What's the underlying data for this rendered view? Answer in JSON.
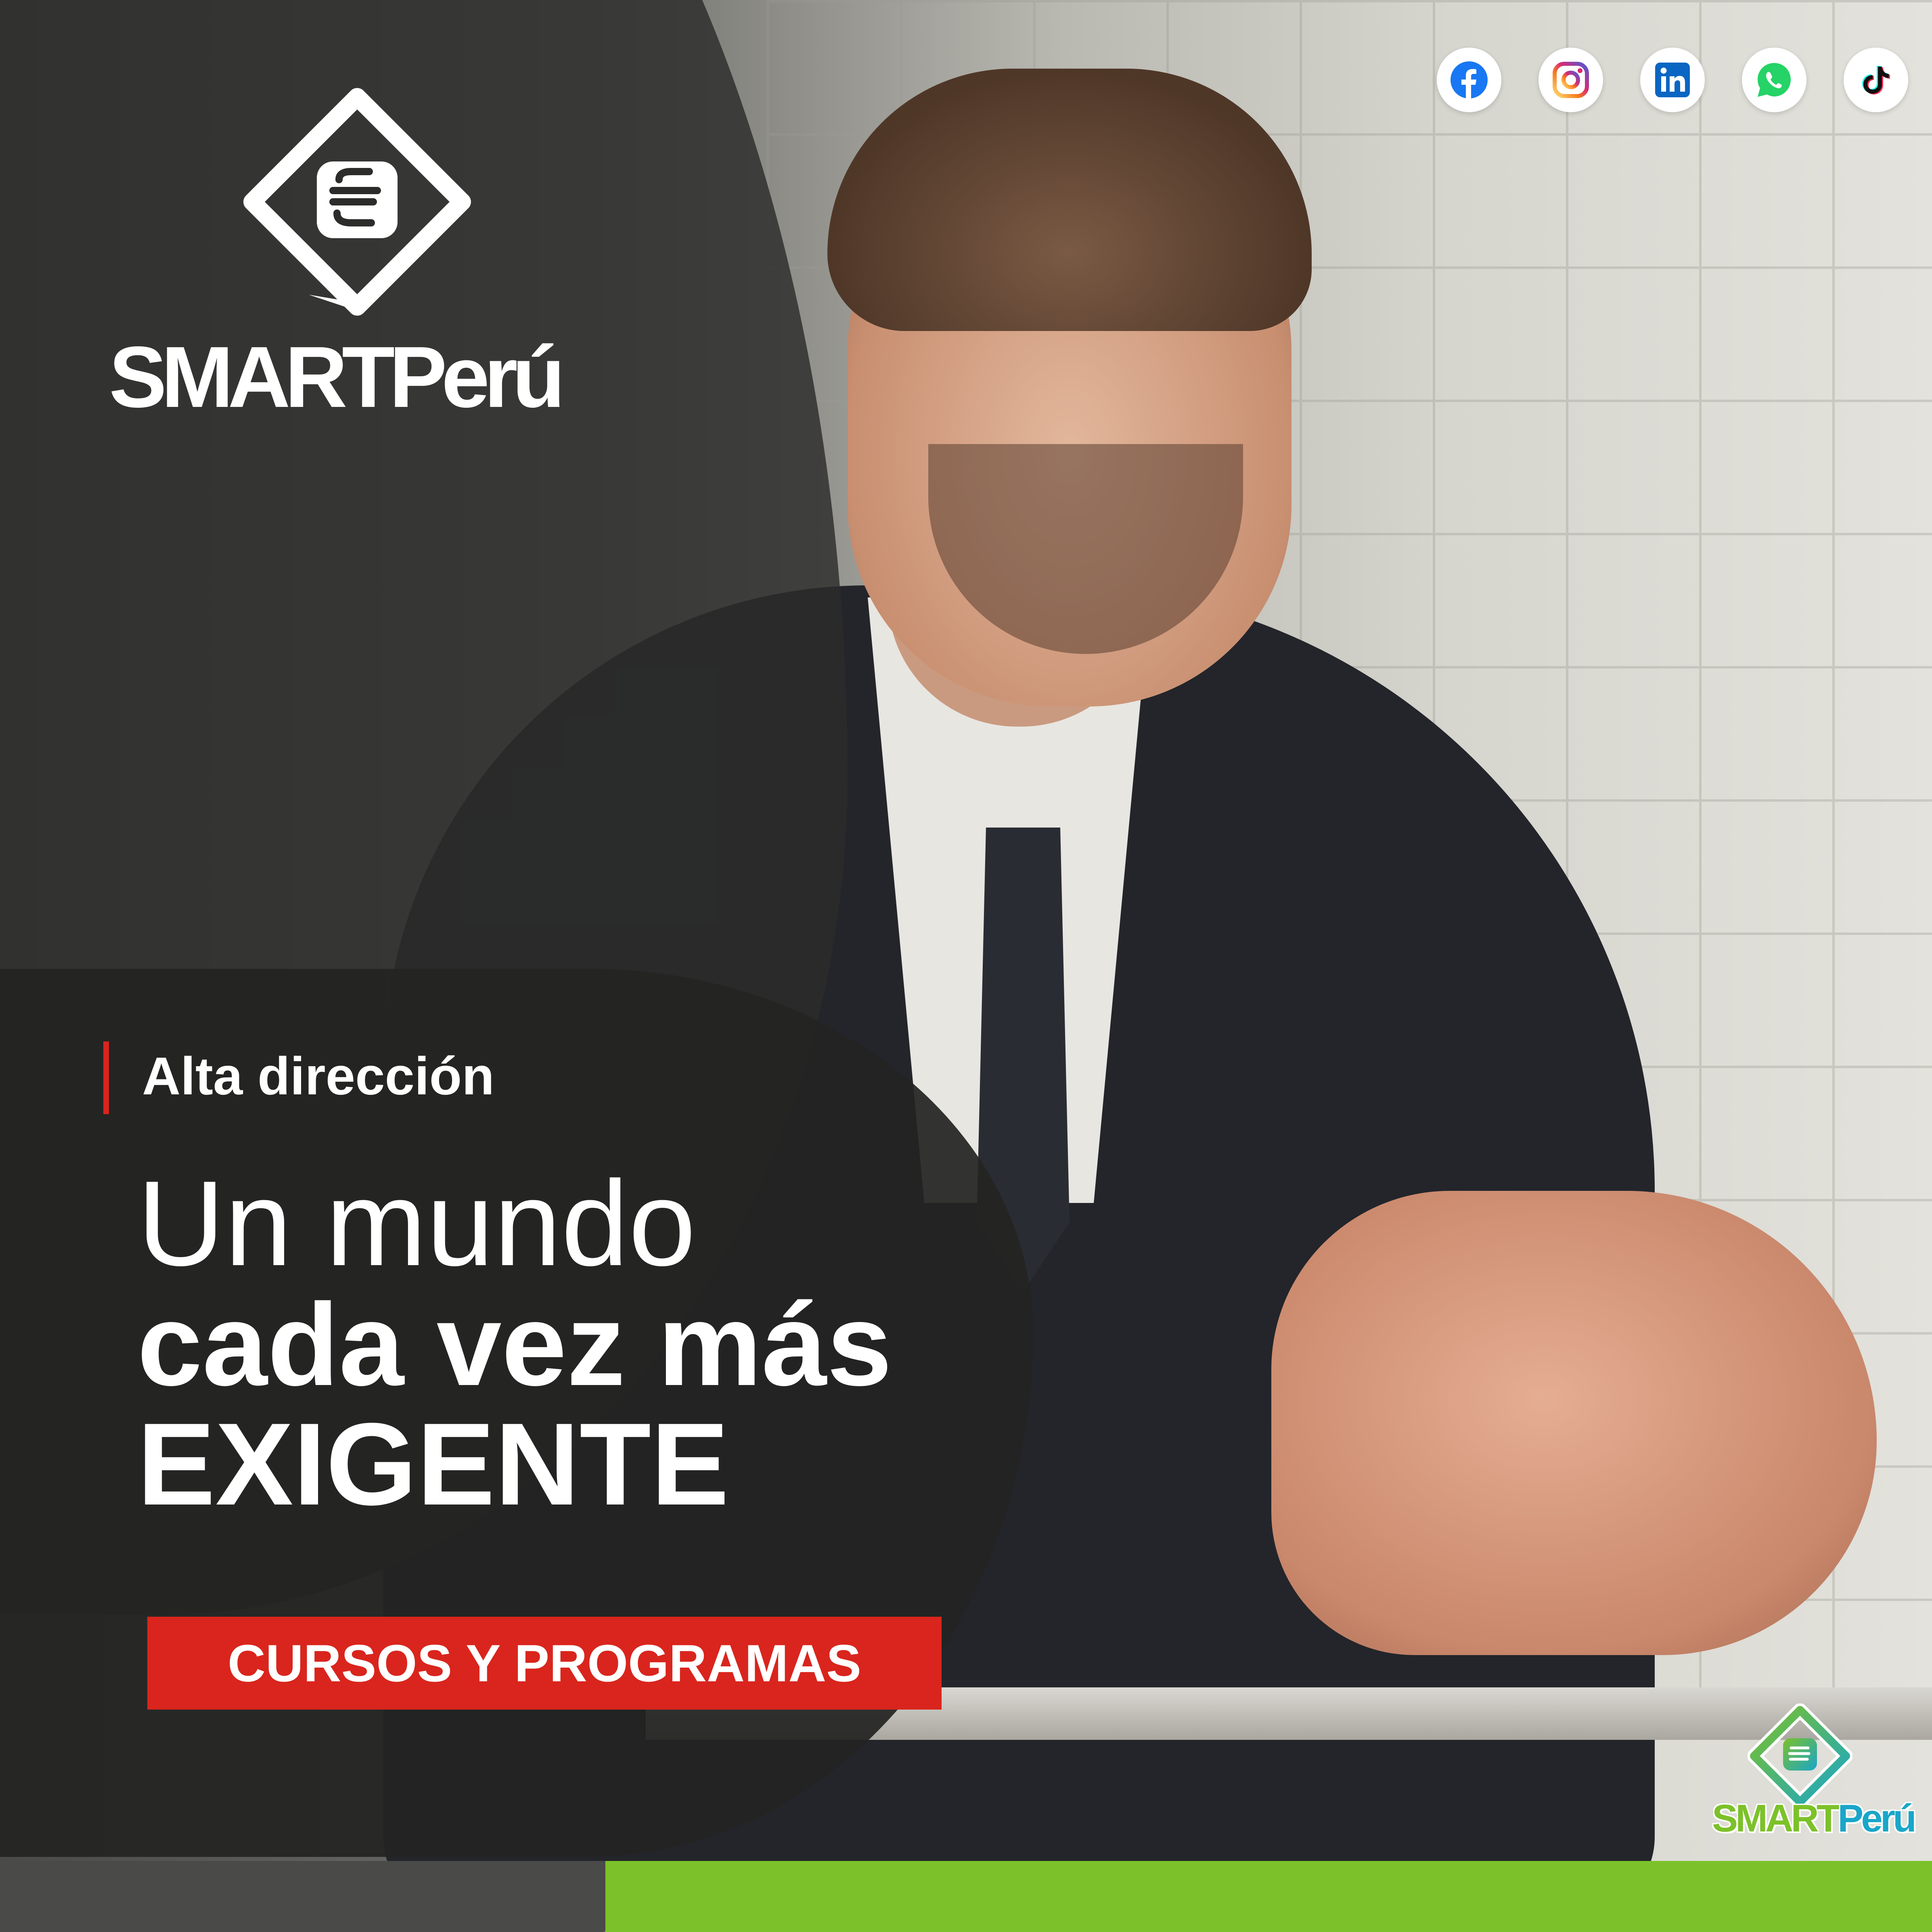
{
  "brand": {
    "name": "SMARTPerú",
    "mini_name_part1": "SMART",
    "mini_name_part2": "Perú",
    "colors": {
      "accent_red": "#d9251d",
      "accent_green": "#7cc12a",
      "accent_cyan": "#1aa6c9",
      "dark_panel": "#2c2c2b"
    }
  },
  "social": [
    {
      "icon": "facebook-icon",
      "color": "#1877f2"
    },
    {
      "icon": "instagram-icon",
      "color": "#c13584"
    },
    {
      "icon": "linkedin-icon",
      "color": "#0a66c2"
    },
    {
      "icon": "whatsapp-icon",
      "color": "#25d366"
    },
    {
      "icon": "tiktok-icon",
      "color": "#111111"
    }
  ],
  "content": {
    "kicker": "Alta dirección",
    "headline_line1": "Un mundo",
    "headline_line2": "cada vez más",
    "headline_line3": "EXIGENTE",
    "cta_label": "CURSOS Y PROGRAMAS"
  }
}
